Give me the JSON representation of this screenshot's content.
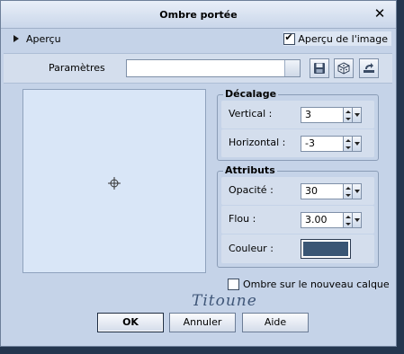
{
  "dialog": {
    "title": "Ombre portée"
  },
  "preview": {
    "expander_label": "Aperçu",
    "apercu_checkbox_label": "Aperçu de l'image",
    "apercu_checked": true
  },
  "params": {
    "label": "Paramètres",
    "combo_value": ""
  },
  "toolbar_icons": [
    "save-icon",
    "dice-random-icon",
    "reset-icon"
  ],
  "decalage": {
    "title": "Décalage",
    "vertical_label": "Vertical :",
    "vertical_value": "3",
    "horizontal_label": "Horizontal :",
    "horizontal_value": "-3"
  },
  "attributs": {
    "title": "Attributs",
    "opacite_label": "Opacité :",
    "opacite_value": "30",
    "flou_label": "Flou :",
    "flou_value": "3.00",
    "couleur_label": "Couleur :",
    "couleur_hex": "#3a5674"
  },
  "new_layer": {
    "label": "Ombre sur le nouveau calque",
    "checked": false
  },
  "signature": "Titoune",
  "buttons": {
    "ok": "OK",
    "cancel": "Annuler",
    "help": "Aide"
  }
}
